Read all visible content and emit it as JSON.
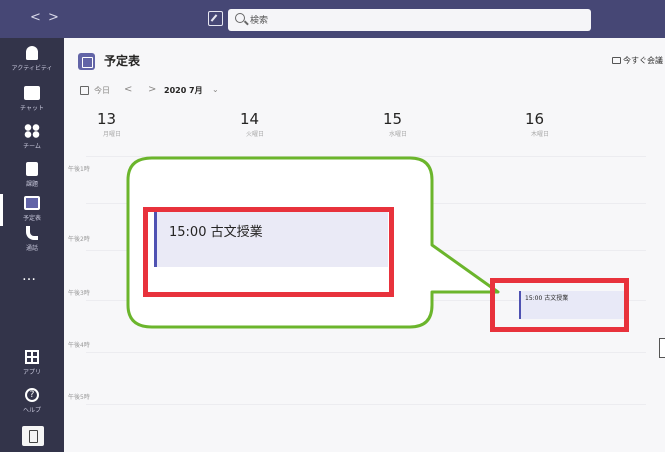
{
  "titlebar": {
    "back_label": "<",
    "forward_label": ">",
    "search_placeholder": "検索"
  },
  "rail": {
    "items": [
      {
        "label": "アクティビティ"
      },
      {
        "label": "チャット"
      },
      {
        "label": "チーム"
      },
      {
        "label": "課題"
      },
      {
        "label": "予定表"
      },
      {
        "label": "通話"
      },
      {
        "label": "…"
      }
    ],
    "apps_label": "アプリ",
    "help_label": "ヘルプ"
  },
  "header": {
    "title": "予定表",
    "meet_now_label": "今すぐ会議"
  },
  "toolbar": {
    "today_label": "今日",
    "prev_label": "<",
    "next_label": ">",
    "month_label": "2020 7月",
    "month_chevron": "⌄"
  },
  "days": [
    {
      "num": "13",
      "weekday": "月曜日"
    },
    {
      "num": "14",
      "weekday": "火曜日"
    },
    {
      "num": "15",
      "weekday": "水曜日"
    },
    {
      "num": "16",
      "weekday": "木曜日"
    }
  ],
  "time_labels": [
    "午後1時",
    "午後2時",
    "午後3時",
    "午後4時",
    "午後5時"
  ],
  "event": {
    "label": "15:00 古文授業",
    "zoom_label": "15:00 古文授業"
  },
  "colors": {
    "titlebar": "#464775",
    "rail": "#33344a",
    "accent": "#6264a7",
    "callout_green": "#6bb52c",
    "highlight_red": "#e8323c"
  }
}
